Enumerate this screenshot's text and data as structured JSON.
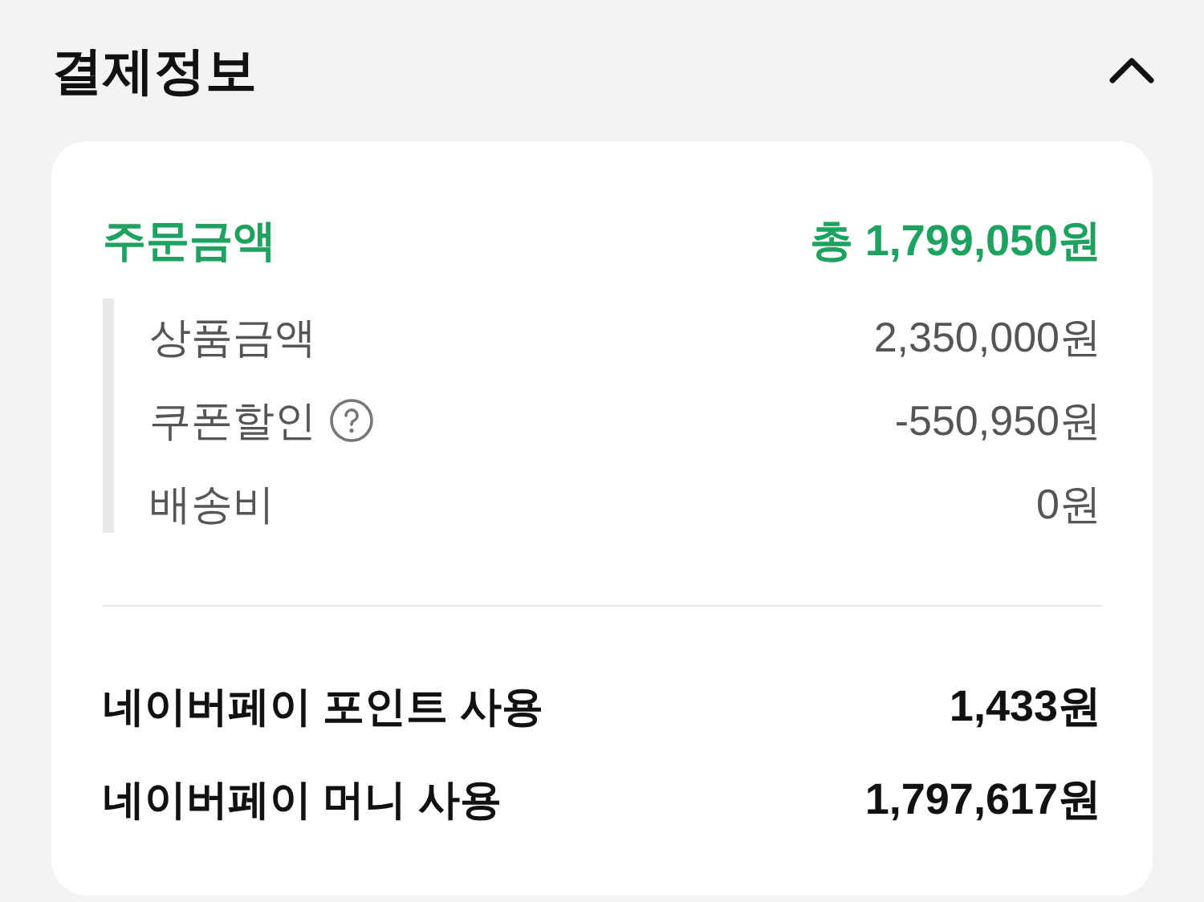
{
  "section": {
    "title": "결제정보",
    "expanded": true
  },
  "order_total": {
    "label": "주문금액",
    "value": "총 1,799,050원"
  },
  "breakdown": [
    {
      "label": "상품금액",
      "value": "2,350,000원",
      "help": false
    },
    {
      "label": "쿠폰할인",
      "value": "-550,950원",
      "help": true
    },
    {
      "label": "배송비",
      "value": "0원",
      "help": false
    }
  ],
  "payments": [
    {
      "label": "네이버페이 포인트 사용",
      "value": "1,433원"
    },
    {
      "label": "네이버페이 머니 사용",
      "value": "1,797,617원"
    }
  ]
}
